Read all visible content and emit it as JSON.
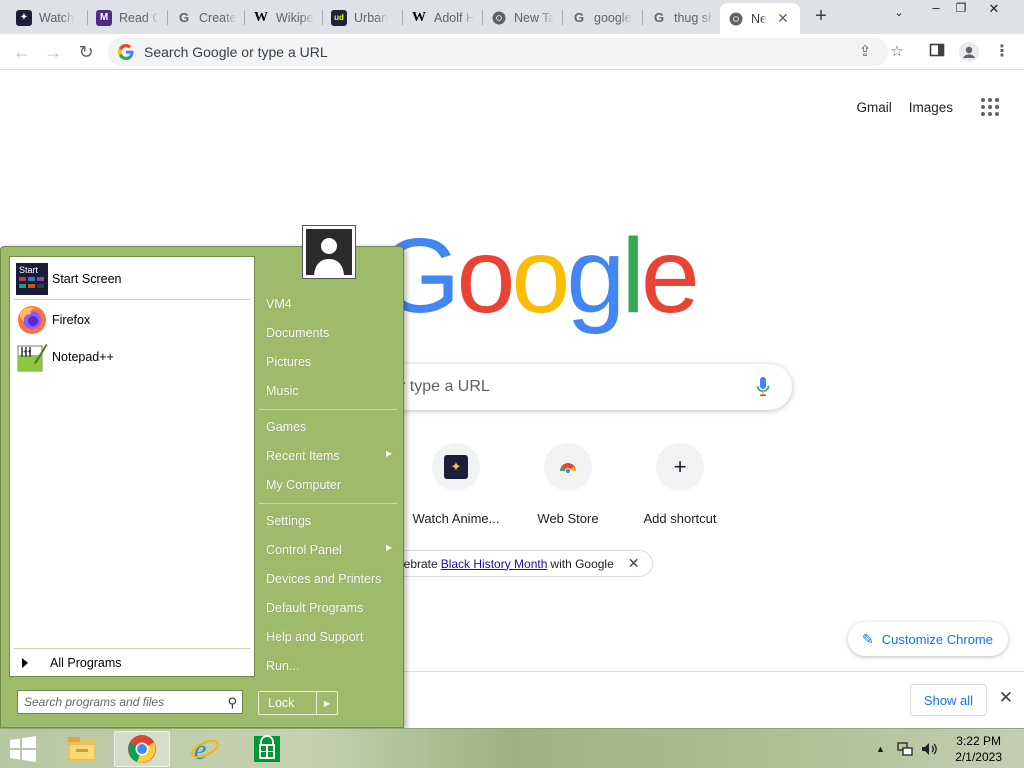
{
  "tabs": [
    {
      "title": "Watch",
      "favicon": "anime-icon"
    },
    {
      "title": "Read C",
      "favicon": "manga-icon"
    },
    {
      "title": "Create",
      "favicon": "google-icon"
    },
    {
      "title": "Wikipe",
      "favicon": "wikipedia-icon"
    },
    {
      "title": "Urban",
      "favicon": "urban-dictionary-icon"
    },
    {
      "title": "Adolf H",
      "favicon": "wikipedia-icon"
    },
    {
      "title": "New Ta",
      "favicon": "chrome-icon"
    },
    {
      "title": "google",
      "favicon": "google-icon"
    },
    {
      "title": "thug sh",
      "favicon": "google-icon"
    },
    {
      "title": "Ne",
      "favicon": "chrome-icon",
      "active": true
    }
  ],
  "toolbar": {
    "omnibox_placeholder": "Search Google or type a URL"
  },
  "ntp": {
    "top_links": [
      "Gmail",
      "Images"
    ],
    "search_placeholder": "Search Google or type a URL",
    "search_visible_text": "r type a URL",
    "shortcuts": [
      {
        "label": "Watch Anime...",
        "icon": "anime-icon"
      },
      {
        "label": "Web Store",
        "icon": "chrome-web-store-icon"
      },
      {
        "label": "Add shortcut",
        "icon": "plus-icon"
      }
    ],
    "doodle": {
      "prefix": "lebrate",
      "link": "Black History Month",
      "suffix": "with Google"
    },
    "customize_label": "Customize Chrome",
    "download_bar": {
      "show_all": "Show all"
    }
  },
  "start_menu": {
    "pinned": [
      {
        "label": "Start Screen",
        "icon": "start-screen-icon"
      },
      {
        "label": "Firefox",
        "icon": "firefox-icon"
      },
      {
        "label": "Notepad++",
        "icon": "notepadpp-icon"
      }
    ],
    "all_programs": "All Programs",
    "search_placeholder": "Search programs and files",
    "right_items": [
      {
        "label": "VM4"
      },
      {
        "label": "Documents"
      },
      {
        "label": "Pictures"
      },
      {
        "label": "Music"
      },
      {
        "label": "Games"
      },
      {
        "label": "Recent Items",
        "submenu": true
      },
      {
        "label": "My Computer"
      },
      {
        "label": "Settings"
      },
      {
        "label": "Control Panel",
        "submenu": true
      },
      {
        "label": "Devices and Printers"
      },
      {
        "label": "Default Programs"
      },
      {
        "label": "Help and Support"
      },
      {
        "label": "Run..."
      }
    ],
    "lock_label": "Lock",
    "accent_color": "#9dbb6b"
  },
  "taskbar": {
    "apps": [
      "file-explorer-icon",
      "chrome-icon",
      "internet-explorer-icon",
      "store-icon"
    ],
    "clock_time": "3:22 PM",
    "clock_date": "2/1/2023"
  }
}
